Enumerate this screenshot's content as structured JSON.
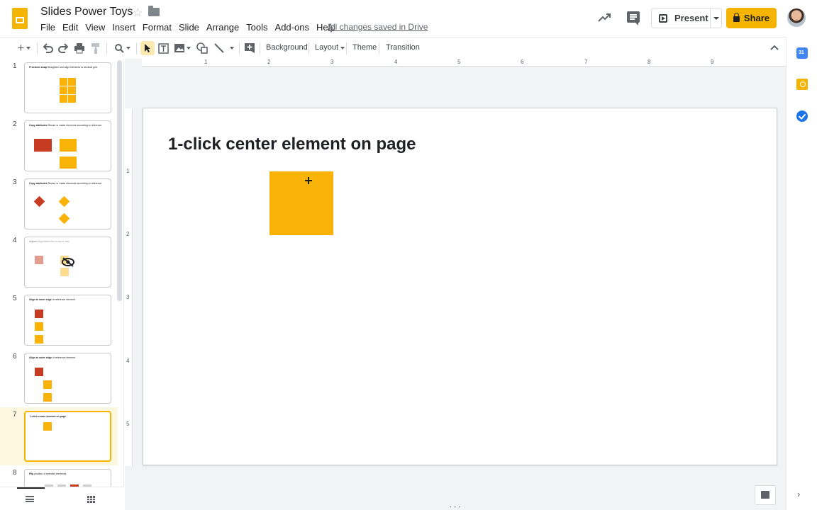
{
  "app": {
    "doc_title": "Slides Power Toys",
    "menu": [
      "File",
      "Edit",
      "View",
      "Insert",
      "Format",
      "Slide",
      "Arrange",
      "Tools",
      "Add-ons",
      "Help"
    ],
    "save_status": "All changes saved in Drive"
  },
  "header_actions": {
    "present_label": "Present",
    "share_label": "Share"
  },
  "toolbar": {
    "background_label": "Background",
    "layout_label": "Layout",
    "theme_label": "Theme",
    "transition_label": "Transition"
  },
  "ruler": {
    "horizontal": [
      "1",
      "2",
      "3",
      "4",
      "5",
      "6",
      "7",
      "8",
      "9"
    ],
    "vertical": [
      "1",
      "2",
      "3",
      "4",
      "5"
    ]
  },
  "filmstrip": {
    "slides": [
      {
        "number": "1",
        "title": "Precision snap",
        "subtitle": "Straighten and align elements to decimal grid"
      },
      {
        "number": "2",
        "title": "Copy attributes",
        "subtitle": "Resize or rotate elements according to reference"
      },
      {
        "number": "3",
        "title": "Copy attributes",
        "subtitle": "Resize or rotate elements according to reference"
      },
      {
        "number": "4",
        "title": "Adjust",
        "subtitle": "Align elements on top or rest"
      },
      {
        "number": "5",
        "title": "Align to inner edge",
        "subtitle": "of reference element"
      },
      {
        "number": "6",
        "title": "Align to outer edge",
        "subtitle": "of reference element"
      },
      {
        "number": "7",
        "title": "1-click center element on page",
        "subtitle": ""
      },
      {
        "number": "8",
        "title": "Flip",
        "subtitle": "position of selected elements"
      }
    ],
    "active_index": 7
  },
  "slide": {
    "title": "1-click center element on page"
  },
  "colors": {
    "accent": "#f4b400",
    "shape_orange": "#f9b208",
    "shape_red": "#c63b21"
  }
}
